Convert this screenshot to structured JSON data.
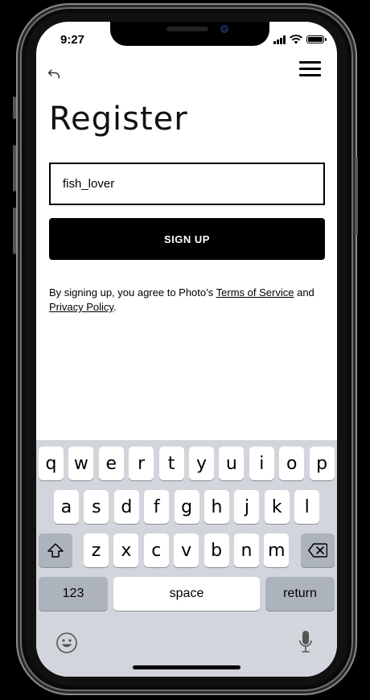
{
  "status_bar": {
    "time": "9:27"
  },
  "header": {
    "back_icon": "undo-arrow-icon",
    "menu_icon": "hamburger-menu-icon"
  },
  "page": {
    "title": "Register",
    "username_value": "fish_lover",
    "signup_label": "SIGN UP",
    "terms_prefix": "By signing up, you agree to Photo’s ",
    "terms_link": "Terms of Service",
    "terms_and": " and ",
    "privacy_link": "Privacy Policy",
    "terms_suffix": "."
  },
  "keyboard": {
    "row1": [
      "q",
      "w",
      "e",
      "r",
      "t",
      "y",
      "u",
      "i",
      "o",
      "p"
    ],
    "row2": [
      "a",
      "s",
      "d",
      "f",
      "g",
      "h",
      "j",
      "k",
      "l"
    ],
    "row3": [
      "z",
      "x",
      "c",
      "v",
      "b",
      "n",
      "m"
    ],
    "numbers_label": "123",
    "space_label": "space",
    "return_label": "return"
  }
}
